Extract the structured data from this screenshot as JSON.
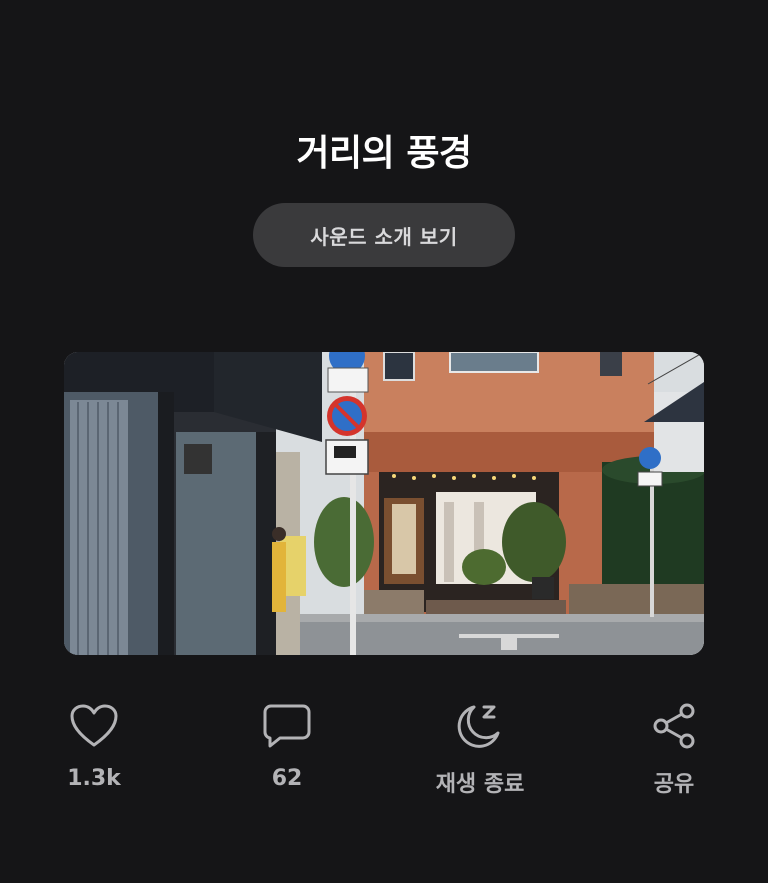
{
  "header": {
    "title": "거리의 풍경",
    "sound_button_label": "사운드 소개 보기"
  },
  "media": {
    "icon": "street-photo"
  },
  "actions": [
    {
      "icon": "heart-icon",
      "label": "1.3k"
    },
    {
      "icon": "chat-bubble-icon",
      "label": "62"
    },
    {
      "icon": "moon-sleep-icon",
      "label": "재생 종료"
    },
    {
      "icon": "share-icon",
      "label": "공유"
    }
  ],
  "colors": {
    "background": "#151517",
    "button_bg": "#3a3a3c",
    "text_primary": "#ffffff",
    "text_secondary": "#b3b3b6"
  }
}
